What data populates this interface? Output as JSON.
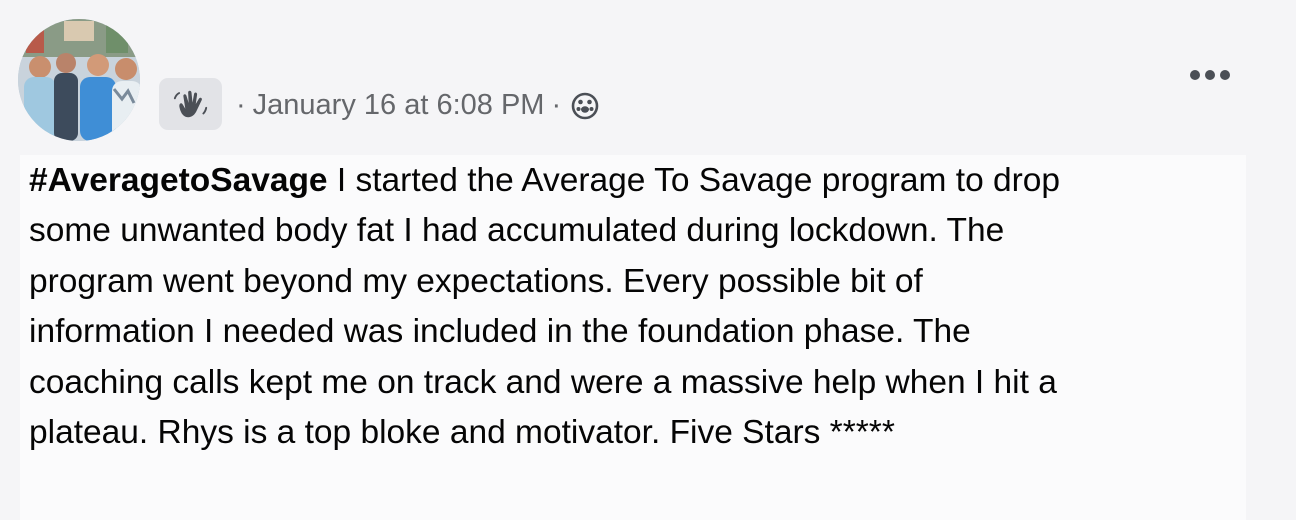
{
  "post": {
    "avatar_icon": "profile-photo-group-icon",
    "wave_icon": "waving-hand-icon",
    "separator": "·",
    "timestamp": "January 16 at 6:08 PM",
    "audience_icon": "group-audience-icon",
    "more_icon": "more-options-icon",
    "hashtag": "#AveragetoSavage",
    "text_lines": [
      " I started the Average To Savage program to drop",
      "some unwanted body fat I had accumulated during lockdown. The",
      "program went beyond my expectations. Every possible bit of",
      "information I needed was included in the foundation phase. The",
      "coaching calls kept me on track and were a massive help when I hit a",
      "plateau. Rhys is a top bloke and motivator. Five Stars *****"
    ]
  },
  "colors": {
    "background": "#f5f5f7",
    "text": "#050505",
    "meta_text": "#65676b",
    "badge_bg": "#e2e3e7"
  }
}
